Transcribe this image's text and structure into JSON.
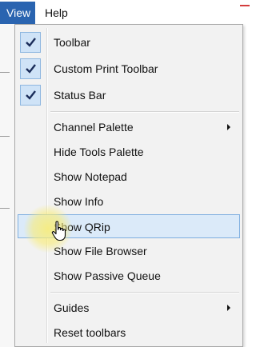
{
  "menubar": {
    "view_label": "View",
    "help_label": "Help"
  },
  "menu": {
    "items": [
      {
        "label": "Toolbar",
        "checked": true
      },
      {
        "label": "Custom Print Toolbar",
        "checked": true
      },
      {
        "label": "Status Bar",
        "checked": true
      },
      {
        "label": "Channel Palette",
        "submenu": true
      },
      {
        "label": "Hide Tools Palette"
      },
      {
        "label": "Show Notepad"
      },
      {
        "label": "Show Info"
      },
      {
        "label": "Show QRip",
        "highlighted": true
      },
      {
        "label": "Show File Browser"
      },
      {
        "label": "Show Passive Queue"
      },
      {
        "label": "Guides",
        "submenu": true
      },
      {
        "label": "Reset toolbars"
      }
    ]
  },
  "colors": {
    "accent": "#2a64b0",
    "highlight_bg": "#dbeaf9",
    "highlight_border": "#7eaee0",
    "check_bg": "#cfe3f7"
  }
}
